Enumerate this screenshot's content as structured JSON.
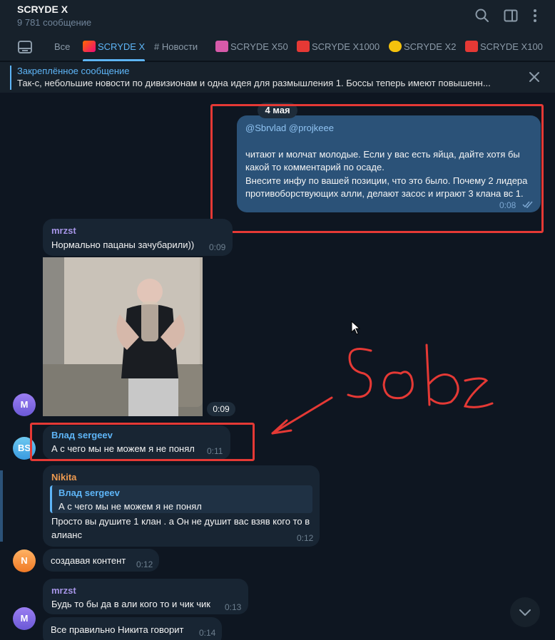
{
  "header": {
    "title": "SCRYDE X",
    "subtitle": "9 781 сообщение",
    "icons": [
      "search-icon",
      "sidebar-toggle-icon",
      "more-vertical-icon"
    ]
  },
  "tabs": [
    {
      "label": "Все",
      "icon": null,
      "active": false
    },
    {
      "label": "SCRYDE X",
      "icon": "fire-emoji-icon",
      "active": true
    },
    {
      "label": "# Новости",
      "icon": null,
      "active": false
    },
    {
      "label": "SCRYDE X50",
      "icon": "pink-emoji-icon",
      "active": false
    },
    {
      "label": "SCRYDE X1000",
      "icon": "hundred-emoji-icon",
      "active": false
    },
    {
      "label": "SCRYDE X2",
      "icon": "number-two-emoji-icon",
      "active": false
    },
    {
      "label": "SCRYDE X100",
      "icon": "hundred-emoji-icon",
      "active": false
    }
  ],
  "pinned": {
    "title": "Закреплённое сообщение",
    "text": "Так-с, небольшие новости по дивизионам и одна идея для размышления  1. Боссы теперь имеют повышенн..."
  },
  "date_label": "4 мая",
  "messages": {
    "m1": {
      "mention": "@Sbrvlad @projkeee",
      "line1": "читают и молчат молодые. Если у вас есть яйца, дайте хотя бы",
      "line2": "какой то комментарий по осаде.",
      "line3": "Внесите инфу по вашей позиции, что это было. Почему 2 лидера",
      "line4": "противоборствующих алли, делают засос и играют 3 клана вс 1.",
      "time": "0:08"
    },
    "m2": {
      "sender": "mrzst",
      "text": "Нормально пацаны зачубарили))",
      "time": "0:09"
    },
    "m3": {
      "time": "0:09",
      "avatar": "M"
    },
    "m4": {
      "sender": "Влад sergeev",
      "text": "А с чего мы не можем я не понял",
      "time": "0:11",
      "avatar": "BS"
    },
    "m5": {
      "sender": "Nikita",
      "reply_sender": "Влад sergeev",
      "reply_text": "А с чего мы не можем я не понял",
      "line1": "Просто вы душите 1 клан . а Он не душит вас взяв кого то в",
      "line2": "алианс",
      "time": "0:12"
    },
    "m6": {
      "text": "создавая контент",
      "time": "0:12",
      "avatar": "N"
    },
    "m7": {
      "sender": "mrzst",
      "text": "Будь то бы да в али кого то и чик чик",
      "time": "0:13"
    },
    "m8": {
      "text": "Все правильно Никита говорит",
      "time": "0:14",
      "avatar": "M"
    }
  },
  "annotation": {
    "text": "sobz",
    "color": "#e53935"
  },
  "colors": {
    "background": "#0e1621",
    "panel": "#17212b",
    "accent": "#5eb5f7",
    "outgoing_bubble": "#2b5278",
    "incoming_bubble": "#182533",
    "sender_mrzst": "#a695e7",
    "sender_vlad": "#5eb5f7",
    "sender_nikita": "#ee9a50",
    "highlight": "#e53935"
  }
}
